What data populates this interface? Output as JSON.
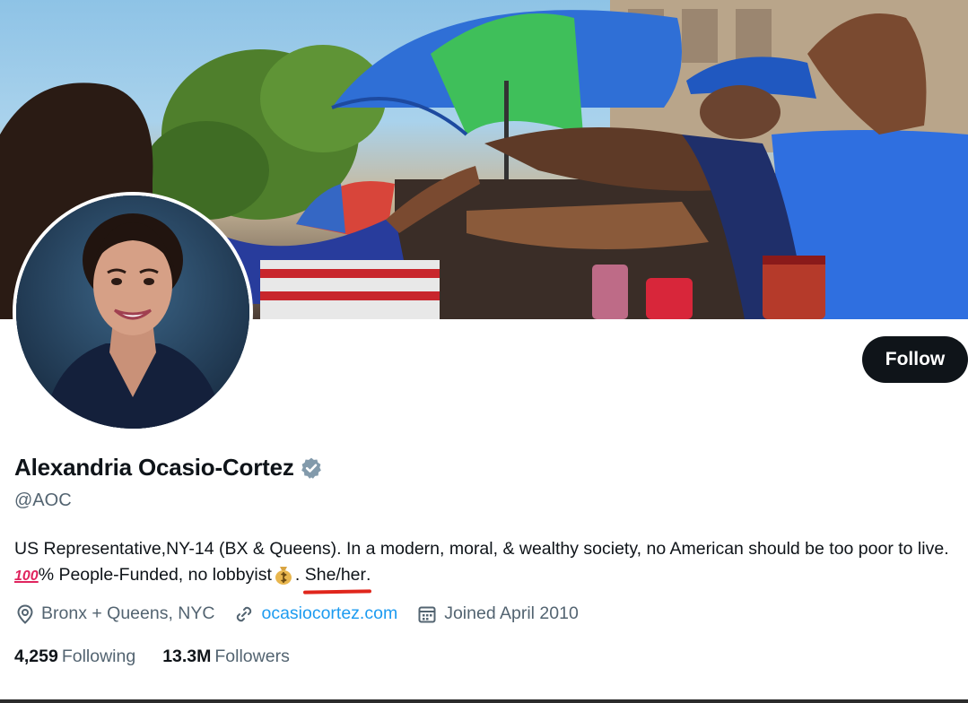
{
  "profile": {
    "display_name": "Alexandria Ocasio-Cortez",
    "handle": "@AOC",
    "verified_icon": "verified-badge-icon",
    "follow_label": "Follow",
    "bio": {
      "text_1": "US Representative,NY-14 (BX & Queens). In a modern, moral, & wealthy society, no American should be too poor to live. ",
      "emoji_100": "100",
      "text_2": "% People-Funded, no lobbyist",
      "money_bag_icon": "money-bag-icon",
      "text_3": ". ",
      "pronouns": "She/her",
      "text_4": "."
    },
    "meta": {
      "location_icon": "location-pin-icon",
      "location": "Bronx + Queens, NYC",
      "link_icon": "link-icon",
      "website": "ocasiocortez.com",
      "calendar_icon": "calendar-icon",
      "joined": "Joined April 2010"
    },
    "stats": {
      "following_count": "4,259",
      "following_label": "Following",
      "followers_count": "13.3M",
      "followers_label": "Followers"
    }
  },
  "colors": {
    "follow_button_bg": "#0f1419",
    "link": "#1d9bf0",
    "secondary_text": "#536471",
    "pronoun_underline": "#e0261c"
  }
}
